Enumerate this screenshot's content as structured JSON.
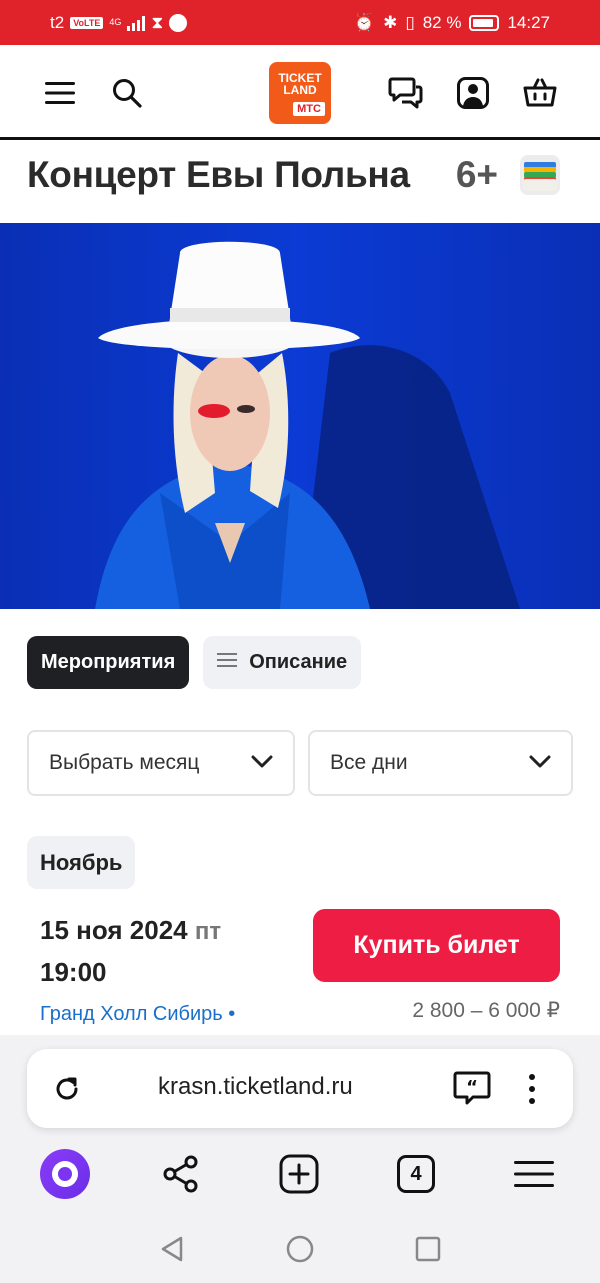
{
  "status_bar": {
    "carrier": "t2",
    "volte": "VoLTE",
    "network": "4G",
    "battery_percent": "82 %",
    "time": "14:27"
  },
  "header": {
    "logo_line1": "TICKET",
    "logo_line2": "LAND",
    "logo_badge": "МТС",
    "icons": [
      "menu-icon",
      "search-icon",
      "chat-icon",
      "profile-icon",
      "basket-icon"
    ]
  },
  "event": {
    "title": "Концерт Евы Польна",
    "age_rating": "6+"
  },
  "tabs": {
    "events": "Мероприятия",
    "description": "Описание"
  },
  "filters": {
    "month_select": "Выбрать месяц",
    "days_select": "Все дни"
  },
  "schedule": {
    "month": "Ноябрь",
    "date": "15 ноя 2024",
    "weekday": "пт",
    "time": "19:00",
    "buy_label": "Купить билет",
    "venue": "Гранд Холл Сибирь •",
    "price": "2 800 – 6 000 ₽"
  },
  "browser": {
    "url": "krasn.ticketland.ru",
    "tabs_count": "4"
  },
  "colors": {
    "status_bar": "#e0222a",
    "buy_button": "#ee1d44",
    "hero_bg": "#0b3bd4",
    "link": "#1a6fcc"
  }
}
